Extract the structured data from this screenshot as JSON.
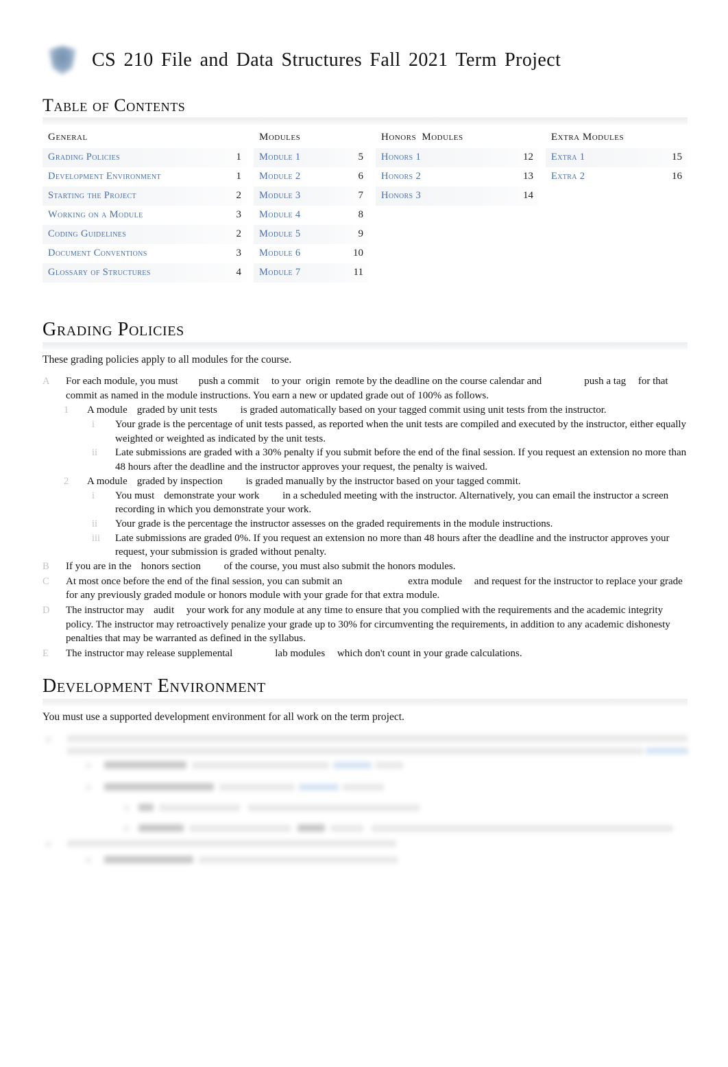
{
  "document": {
    "title": "CS 210 File and Data Structures Fall 2021 Term Project",
    "logo_icon": "shield-logo-icon"
  },
  "toc": {
    "heading": "Table of Contents",
    "columns": [
      {
        "title": "General",
        "entries": [
          {
            "label": "Grading Policies",
            "page": "1"
          },
          {
            "label": "Development Environment",
            "page": "1"
          },
          {
            "label": "Starting the Project",
            "page": "2"
          },
          {
            "label": "Working on a Module",
            "page": "3"
          },
          {
            "label": "Coding Guidelines",
            "page": "2"
          },
          {
            "label": "Document Conventions",
            "page": "3"
          },
          {
            "label": "Glossary of Structures",
            "page": "4"
          }
        ]
      },
      {
        "title": "Modules",
        "entries": [
          {
            "label": "Module 1",
            "page": "5"
          },
          {
            "label": "Module 2",
            "page": "6"
          },
          {
            "label": "Module 3",
            "page": "7"
          },
          {
            "label": "Module 4",
            "page": "8"
          },
          {
            "label": "Module 5",
            "page": "9"
          },
          {
            "label": "Module 6",
            "page": "10"
          },
          {
            "label": "Module 7",
            "page": "11"
          }
        ]
      },
      {
        "title": "Honors Modules",
        "entries": [
          {
            "label": "Honors 1",
            "page": "12"
          },
          {
            "label": "Honors 2",
            "page": "13"
          },
          {
            "label": "Honors 3",
            "page": "14"
          }
        ]
      },
      {
        "title": "Extra Modules",
        "entries": [
          {
            "label": "Extra 1",
            "page": "15"
          },
          {
            "label": "Extra 2",
            "page": "16"
          }
        ]
      }
    ]
  },
  "grading_policies": {
    "heading": "Grading Policies",
    "lead": "These grading policies apply to all modules for the course.",
    "items": {
      "a_marker": "A",
      "a_text_1": "For each module, you must",
      "a_term_1": "push a commit",
      "a_text_2": "to your",
      "a_term_2": "origin",
      "a_text_3": "remote by the deadline on the course calendar and",
      "a_term_3": "push a tag",
      "a_text_4": "for that commit as named in the module instructions. You earn a new or updated grade out of 100% as follows.",
      "a1_marker": "1",
      "a1_text_1": "A module",
      "a1_term_1": "graded by unit tests",
      "a1_text_2": "is graded automatically based on your tagged commit using unit tests from the instructor.",
      "a1i_marker": "i",
      "a1i_text": "Your grade is the percentage of unit tests passed, as reported when the unit tests are compiled and executed by the instructor, either equally weighted or weighted as indicated by the unit tests.",
      "a1ii_marker": "ii",
      "a1ii_text": "Late submissions are graded with a 30% penalty if you submit before the end of the final session. If you request an extension no more than 48 hours after the deadline and the instructor approves your request, the penalty is waived.",
      "a2_marker": "2",
      "a2_text_1": "A module",
      "a2_term_1": "graded by inspection",
      "a2_text_2": "is graded manually by the instructor based on your tagged commit.",
      "a2i_marker": "i",
      "a2i_text_1": "You must",
      "a2i_term_1": "demonstrate your work",
      "a2i_text_2": "in a scheduled meeting with the instructor. Alternatively, you can email the instructor a screen recording in which you demonstrate your work.",
      "a2ii_marker": "ii",
      "a2ii_text": "Your grade is the percentage the instructor assesses on the graded requirements in the module instructions.",
      "a2iii_marker": "iii",
      "a2iii_text": "Late submissions are graded 0%. If you request an extension no more than 48 hours after the deadline and the instructor approves your request, your submission is graded without penalty.",
      "b_marker": "B",
      "b_text_1": "If you are in the",
      "b_term_1": "honors section",
      "b_text_2": "of the course, you must also submit the honors modules.",
      "c_marker": "C",
      "c_text_1": "At most once before the end of the final session, you can submit an",
      "c_term_1": "extra module",
      "c_text_2": "and request for the instructor to replace your grade for any previously graded module or honors module with your grade for that extra module.",
      "d_marker": "D",
      "d_text_1": "The instructor may",
      "d_term_1": "audit",
      "d_text_2": "your work for any module at any time to ensure that you complied with the requirements and the academic integrity policy. The instructor may retroactively penalize your grade up to 30% for circumventing the requirements, in addition to any academic dishonesty penalties that may be warranted as defined in the syllabus.",
      "e_marker": "E",
      "e_text_1": "The instructor may release supplemental",
      "e_term_1": "lab modules",
      "e_text_2": "which don't count in your grade calculations."
    }
  },
  "development_environment": {
    "heading": "Development Environment",
    "lead": "You must use a supported development environment for all work on the term project.",
    "obscured_note": "blurred-illegible-content"
  },
  "colors": {
    "link_blue": "#4a6ea9",
    "marker_gray": "#c3c3c3",
    "rule_bar": "#eceef0",
    "text": "#111111"
  }
}
